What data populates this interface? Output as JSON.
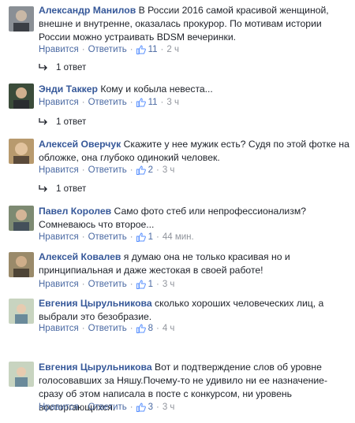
{
  "labels": {
    "like": "Нравится",
    "reply": "Ответить",
    "dot": "·"
  },
  "colors": {
    "author": "#365899",
    "link": "#4b6aa3",
    "meta": "#90949c",
    "like_icon": "#5890ff"
  },
  "comments": [
    {
      "author": "Александр Манилов",
      "text": "В России 2016 самой красивой женщиной, внешне и внутренне, оказалась прокурор. По мотивам истории России можно устраивать BDSM вечеринки.",
      "likes": "11",
      "time": "2 ч",
      "replies": "1 ответ"
    },
    {
      "author": "Энди Таккер",
      "text": "Кому и кобыла невеста...",
      "likes": "11",
      "time": "3 ч",
      "replies": "1 ответ"
    },
    {
      "author": "Алексей Оверчук",
      "text": "Скажите у нее мужик есть? Судя по этой фотке на обложке, она глубоко одинокий человек.",
      "likes": "2",
      "time": "3 ч",
      "replies": "1 ответ"
    },
    {
      "author": "Павел Королев",
      "text": "Само фото стеб или непрофессионализм? Сомневаюсь что второе...",
      "likes": "1",
      "time": "44 мин."
    },
    {
      "author": "Алексей Ковалев",
      "text": "я думаю она не только красивая но и принципиальная и даже жестокая в своей работе!",
      "likes": "1",
      "time": "3 ч"
    },
    {
      "author": "Евгения Цырульникова",
      "text": "сколько хороших человеческих лиц, а выбрали это безобразие.",
      "likes": "8",
      "time": "4 ч"
    },
    {
      "author": "Евгения Цырульникова",
      "text": "Вот и подтверждение слов об уровне голосовавших за Няшу.Почему-то не удивило ни ее назначение-сразу об этом написала в посте с конкурсом, ни уровень восторгающихся.",
      "likes": "3",
      "time": "3 ч"
    }
  ]
}
